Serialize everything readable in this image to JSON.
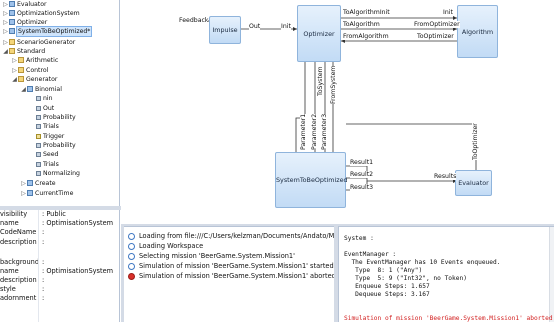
{
  "tree": {
    "items": [
      {
        "label": "Evaluator",
        "icon": "class-icon",
        "toggle": "▷"
      },
      {
        "label": "OptimizationSystem",
        "icon": "class-icon",
        "toggle": "▷"
      },
      {
        "label": "Optimizer",
        "icon": "class-icon",
        "toggle": "▷"
      },
      {
        "label": "SystemToBeOptimized*",
        "icon": "class-icon",
        "toggle": "▷",
        "selected": true
      },
      {
        "label": "ScenarioGenerator",
        "icon": "folder-icon",
        "toggle": "▷"
      },
      {
        "label": "Standard",
        "icon": "folder-icon",
        "toggle": "◢"
      },
      {
        "label": "Arithmetic",
        "icon": "folder-icon",
        "toggle": "▷"
      },
      {
        "label": "Control",
        "icon": "folder-icon",
        "toggle": "▷"
      },
      {
        "label": "Generator",
        "icon": "folder-icon",
        "toggle": "◢"
      },
      {
        "label": "Binomial",
        "icon": "class-icon",
        "toggle": "◢"
      },
      {
        "label": "nin",
        "icon": "property-icon",
        "toggle": ""
      },
      {
        "label": "Out",
        "icon": "property-icon",
        "toggle": ""
      },
      {
        "label": "Probability",
        "icon": "property-icon",
        "toggle": ""
      },
      {
        "label": "Trials",
        "icon": "property-icon",
        "toggle": ""
      },
      {
        "label": "Trigger",
        "icon": "event-icon",
        "toggle": ""
      },
      {
        "label": "Probability",
        "icon": "property-icon",
        "toggle": ""
      },
      {
        "label": "Seed",
        "icon": "property-icon",
        "toggle": ""
      },
      {
        "label": "Trials",
        "icon": "property-icon",
        "toggle": ""
      },
      {
        "label": "Normalizing",
        "icon": "property-icon",
        "toggle": ""
      },
      {
        "label": "Create",
        "icon": "class-icon",
        "toggle": "▷"
      },
      {
        "label": "CurrentTime",
        "icon": "class-icon",
        "toggle": "▷"
      }
    ]
  },
  "properties": {
    "rows": [
      {
        "name": "visibility",
        "value": ": Public"
      },
      {
        "name": "name",
        "value": ": OptimisationSystem"
      },
      {
        "name": "CodeName",
        "value": ":"
      },
      {
        "name": "description",
        "value": ":"
      },
      {
        "name": "",
        "value": ""
      },
      {
        "name": "background",
        "value": ":"
      },
      {
        "name": "name",
        "value": ": OptimisationSystem"
      },
      {
        "name": "description",
        "value": ":"
      },
      {
        "name": "style",
        "value": ":"
      },
      {
        "name": "adornment",
        "value": ":"
      }
    ]
  },
  "diagram": {
    "nodes": {
      "impulse": "Impulse",
      "optimizer": "Optimizer",
      "algorithm": "Algorithm",
      "system": "SystemToBeOptimized",
      "evaluator": "Evaluator"
    },
    "labels": {
      "feedback": "Feedback",
      "out": "Out",
      "init": "Init",
      "to_algorithm_init": "ToAlgorithmInit",
      "init2": "Init",
      "to_algorithm": "ToAlgorithm",
      "from_optimizer": "FromOptimizer",
      "from_algorithm": "FromAlgorithm",
      "to_optimizer": "ToOptimizer",
      "to_system": "ToSystem",
      "from_system": "FromSystem",
      "parameter1": "Parameter1",
      "parameter2": "Parameter2",
      "parameter3": "Parameter3",
      "to_optimizer2": "ToOptimizer",
      "result1": "Result1",
      "result2": "Result2",
      "result3": "Result3",
      "results": "Results"
    }
  },
  "log": {
    "rows": [
      {
        "kind": "info",
        "text": "Loading from file:///C:/Users/kelzman/Documents/Andato/MSArchitect/"
      },
      {
        "kind": "info",
        "text": "Loading Workspace"
      },
      {
        "kind": "info",
        "text": "Selecting mission 'BeerGame.System.Mission1'"
      },
      {
        "kind": "info",
        "text": "Simulation of mission 'BeerGame.System.Mission1' started"
      },
      {
        "kind": "err",
        "text": "Simulation of mission 'BeerGame.System.Mission1' aborted"
      }
    ]
  },
  "console": {
    "rows": [
      {
        "text": "System :",
        "err": false
      },
      {
        "text": "",
        "err": false
      },
      {
        "text": "EventManager :",
        "err": false
      },
      {
        "text": "  The EventManager has 10 Events enqueued.",
        "err": false
      },
      {
        "text": "   Type  8: 1 (\"Any\")",
        "err": false
      },
      {
        "text": "   Type  5: 9 (\"Int32\", no Token)",
        "err": false
      },
      {
        "text": "   Enqueue Steps: 1.657",
        "err": false
      },
      {
        "text": "   Dequeue Steps: 3.167",
        "err": false
      },
      {
        "text": "",
        "err": false
      },
      {
        "text": "",
        "err": false
      },
      {
        "text": "Simulation of mission 'BeerGame.System.Mission1' aborted",
        "err": true
      }
    ]
  }
}
